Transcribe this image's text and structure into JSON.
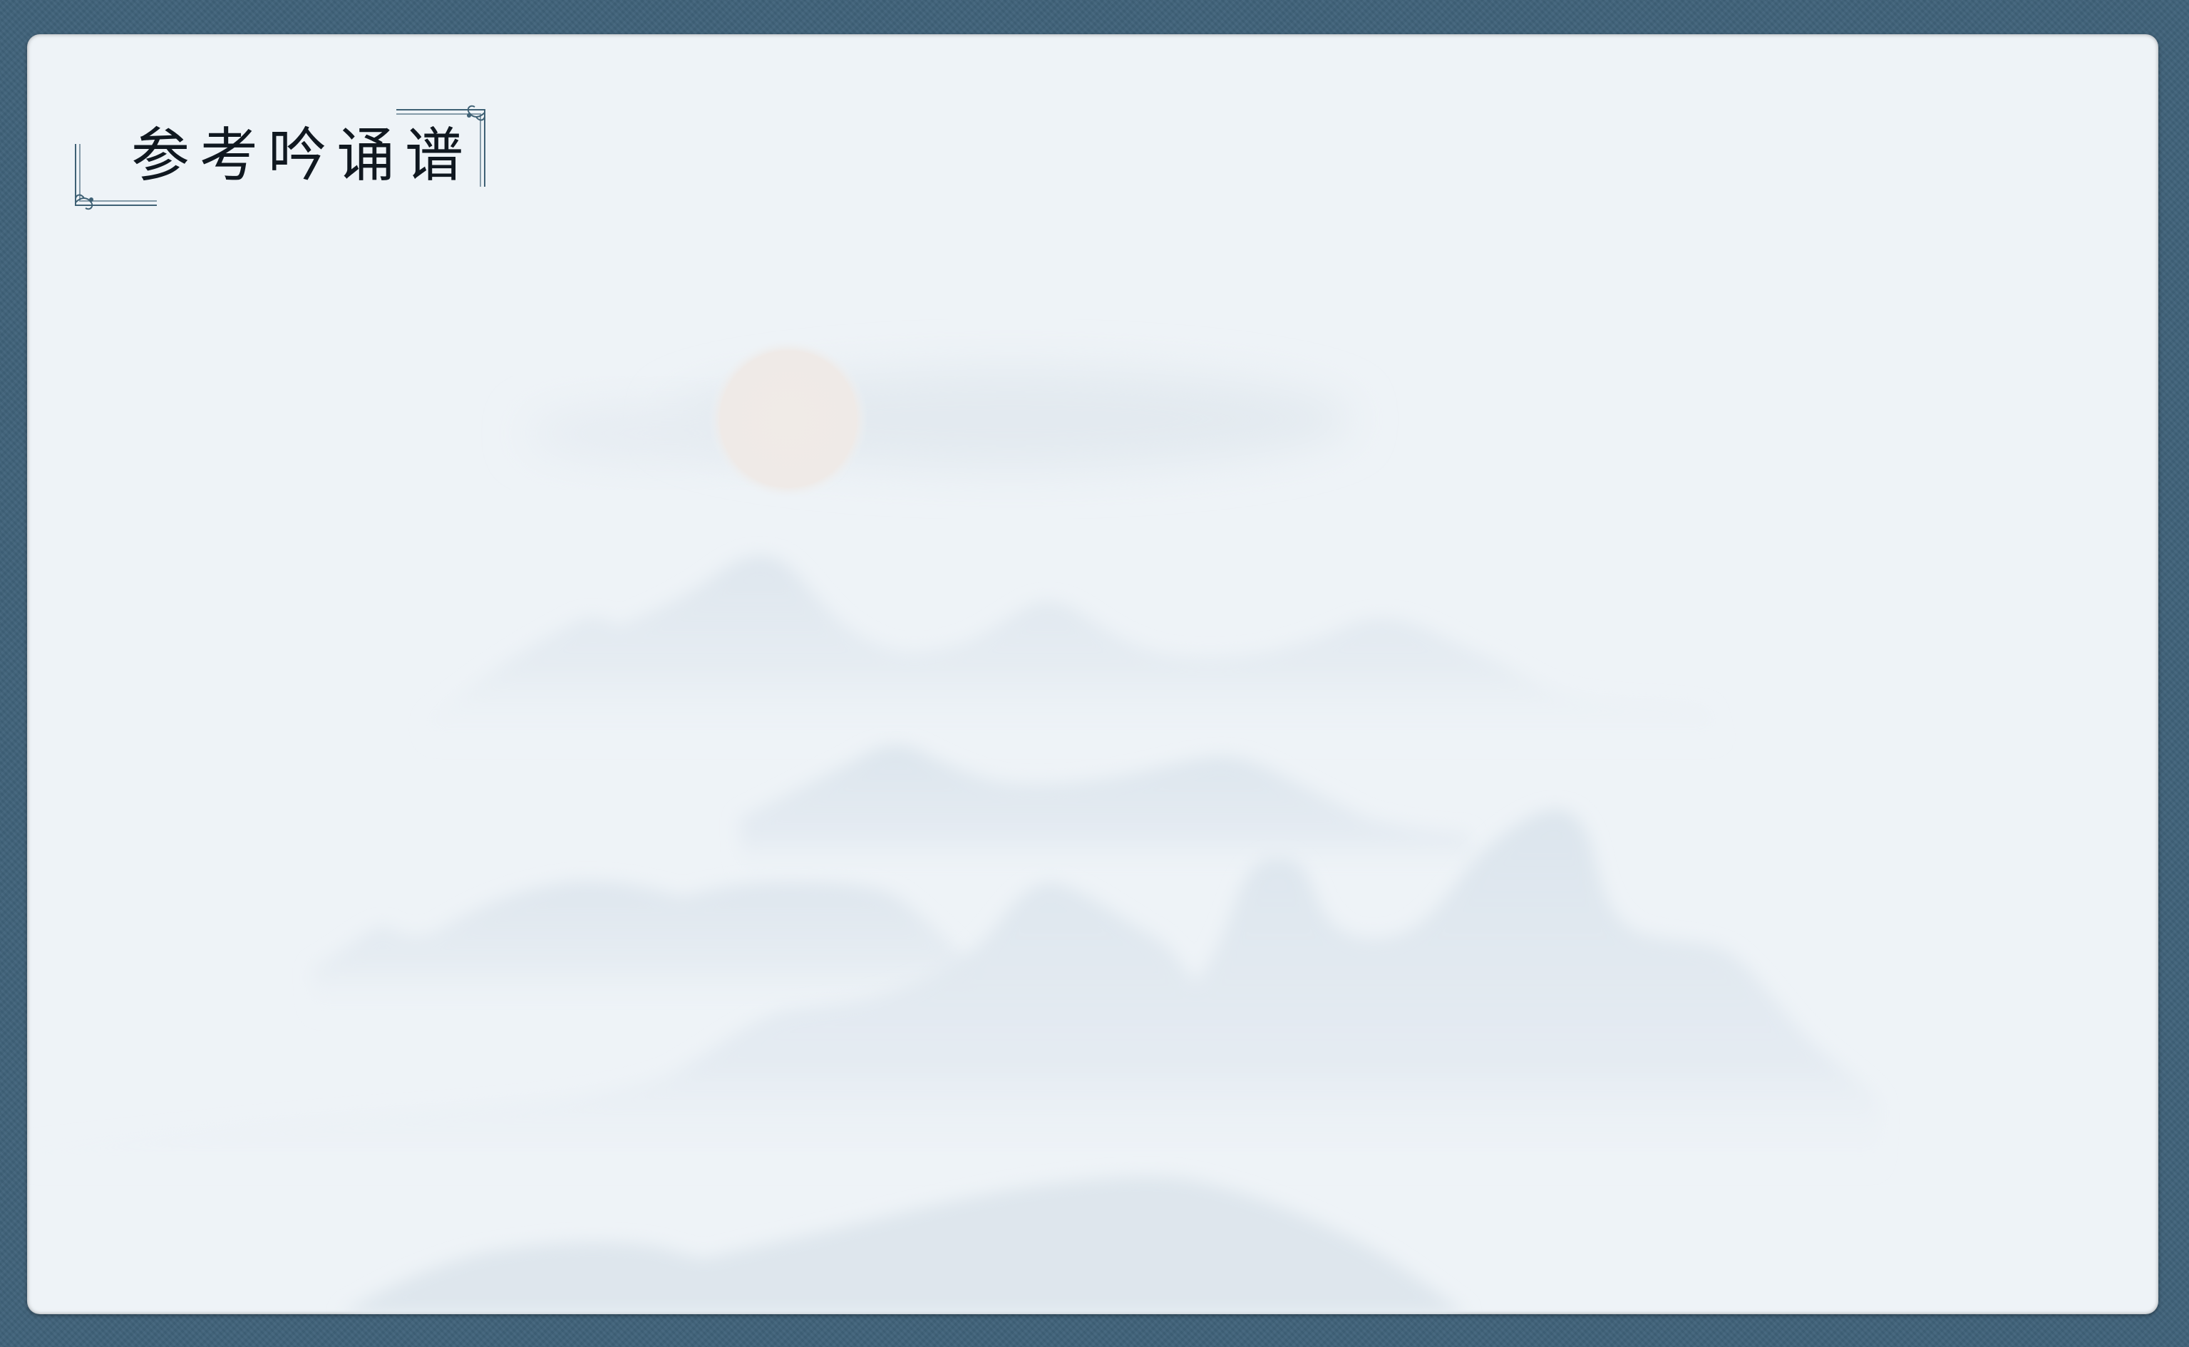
{
  "title": {
    "text": "参考吟诵谱"
  },
  "colors": {
    "frame": "#40627a",
    "paper": "#eef3f7",
    "mountain": "#dfe7ee",
    "sun": "#f1ece8",
    "ornament": "#3f6175"
  },
  "icons": {
    "corner_top_right": "ornament-corner-icon",
    "corner_bottom_left": "ornament-corner-icon"
  }
}
